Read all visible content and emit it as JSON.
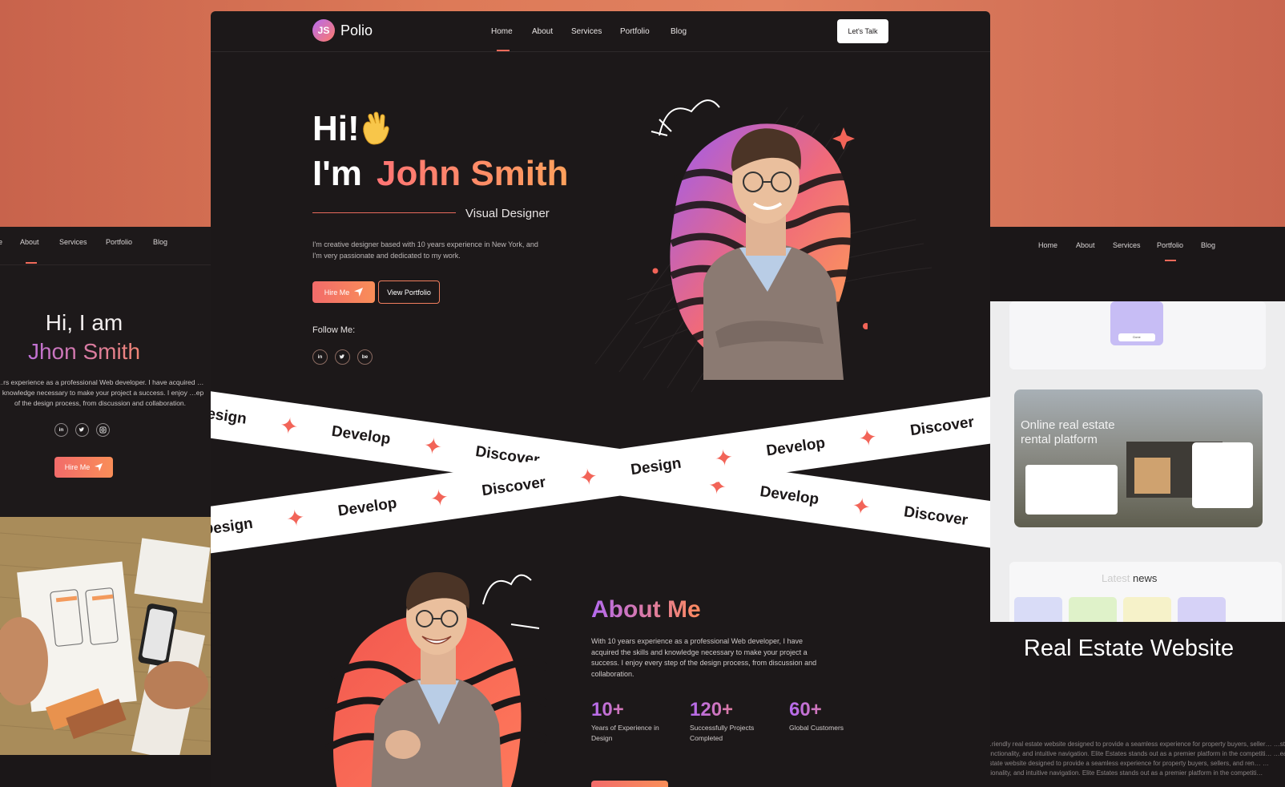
{
  "left_card": {
    "nav": [
      "About",
      "Services",
      "Portfolio",
      "Blog"
    ],
    "greeting": "Hi, I am",
    "name": "Jhon Smith",
    "description": "…rs experience as a professional Web developer. I have acquired …d knowledge necessary to make your project a success. I enjoy …ep of the design process, from discussion and collaboration.",
    "social": [
      "in",
      "tw",
      "ig"
    ],
    "hire_label": "Hire Me"
  },
  "main": {
    "logo_badge": "JS",
    "logo_text": "Polio",
    "nav": [
      "Home",
      "About",
      "Services",
      "Portfolio",
      "Blog"
    ],
    "talk_label": "Let's Talk",
    "hero_hi": "Hi!",
    "hero_im": "I'm",
    "hero_name": "John Smith",
    "hero_role": "Visual Designer",
    "hero_desc": "I'm creative designer based with 10 years experience in New York, and I'm very passionate and dedicated to my work.",
    "hire_label": "Hire Me",
    "view_label": "View Portfolio",
    "follow_label": "Follow Me:",
    "social": [
      "in",
      "tw",
      "be"
    ],
    "ribbon_words": [
      "Design",
      "Develop",
      "Discover"
    ],
    "about_title": "About Me",
    "about_desc": "With 10 years experience as a professional Web developer, I have acquired the skills and knowledge necessary to make your project a success. I enjoy every step of the design process, from discussion and collaboration.",
    "stats": [
      {
        "value": "10+",
        "label": "Years of Experience in Design"
      },
      {
        "value": "120+",
        "label": "Successfully Projects Completed"
      },
      {
        "value": "60+",
        "label": "Global Customers"
      }
    ]
  },
  "right_card": {
    "nav": [
      "Home",
      "About",
      "Services",
      "Portfolio",
      "Blog"
    ],
    "hero_title": "Online real estate rental platform",
    "news_thin": "Latest",
    "news_bold": "news",
    "done_label": "Done",
    "title": "Real Estate Website",
    "description": "…riendly real estate website designed to provide a seamless experience for property buyers, seller… …st functionality, and intuitive navigation. Elite Estates stands out as a premier platform in the competiti… …eal estate website designed to provide a seamless experience for property buyers, sellers, and ren… …ctionality, and intuitive navigation. Elite Estates stands out as a premier platform in the competiti…"
  },
  "colors": {
    "accent_start": "#f26b6a",
    "accent_end": "#f98e58",
    "purple": "#b46af0",
    "background": "#1c1819"
  }
}
